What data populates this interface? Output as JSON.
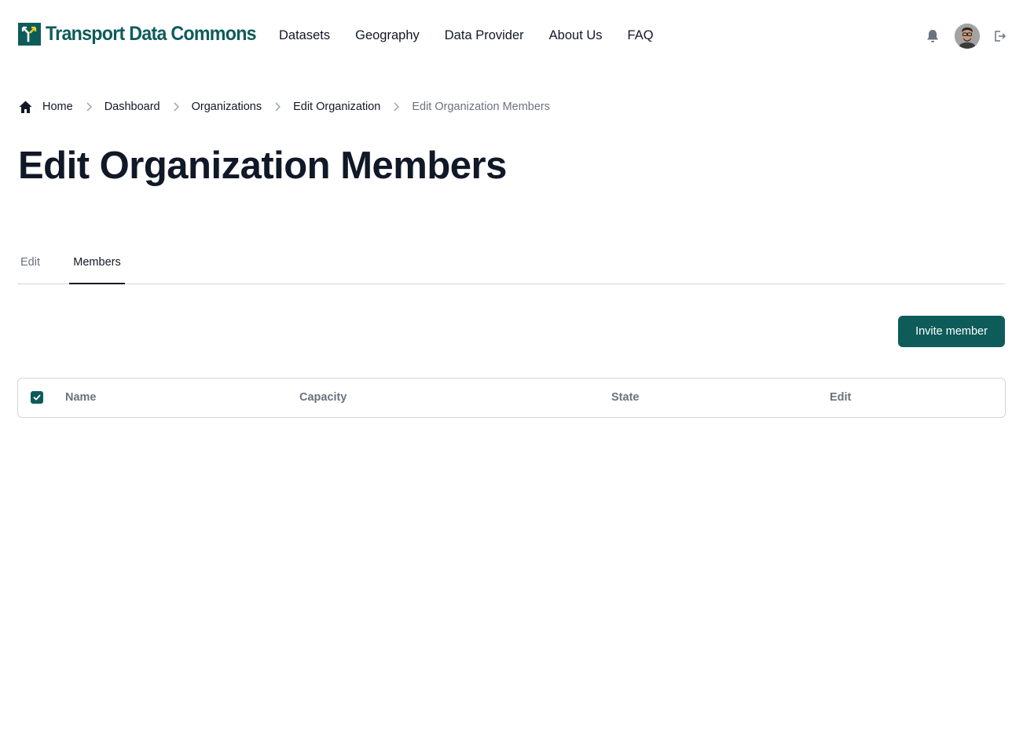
{
  "brand": {
    "name": "Transport Data Commons",
    "color": "#0d5c5a"
  },
  "nav": {
    "items": [
      "Datasets",
      "Geography",
      "Data Provider",
      "About Us",
      "FAQ"
    ]
  },
  "header_icons": {
    "notifications": "bell-icon",
    "avatar": "user-avatar",
    "logout": "logout-icon"
  },
  "breadcrumb": {
    "items": [
      "Home",
      "Dashboard",
      "Organizations",
      "Edit Organization"
    ],
    "current": "Edit Organization Members"
  },
  "page": {
    "title": "Edit Organization Members"
  },
  "tabs": [
    {
      "label": "Edit",
      "active": false
    },
    {
      "label": "Members",
      "active": true
    }
  ],
  "actions": {
    "invite_label": "Invite member"
  },
  "table": {
    "select_all_checked": true,
    "columns": [
      "Name",
      "Capacity",
      "State",
      "Edit"
    ],
    "rows": []
  }
}
